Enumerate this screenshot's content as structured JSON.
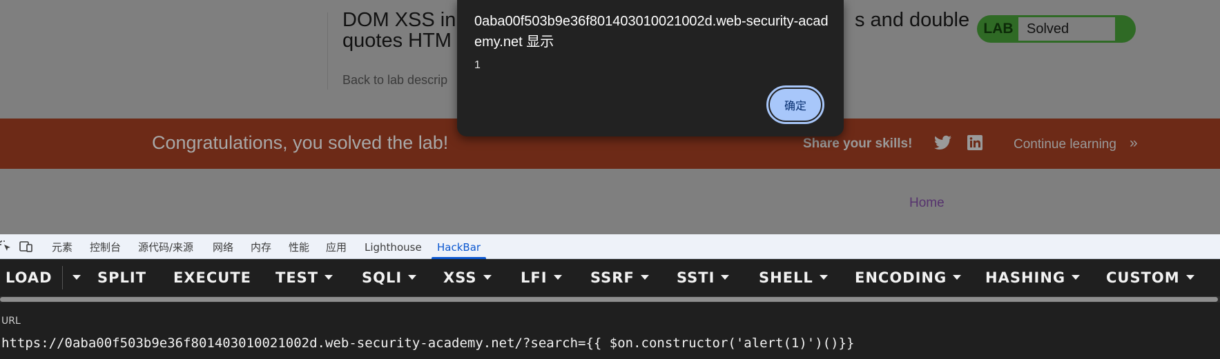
{
  "lab": {
    "title_line1": "DOM XSS in",
    "title_line2": "quotes HTM",
    "title_right": "s and double",
    "back_link": "Back to lab descrip",
    "badge_tag": "LAB",
    "badge_status": "Solved",
    "congrats": "Congratulations, you solved the lab!",
    "share": "Share your skills!",
    "continue": "Continue learning",
    "home": "Home",
    "colors": {
      "banner": "#6d2a17",
      "badge": "#2f6a25"
    }
  },
  "alert": {
    "origin": "0aba00f503b9e36f801403010021002d.web-security-academy.net 显示",
    "message": "1",
    "ok_label": "确定"
  },
  "devtools": {
    "tabs": [
      {
        "label": "元素"
      },
      {
        "label": "控制台"
      },
      {
        "label": "源代码/来源"
      },
      {
        "label": "网络"
      },
      {
        "label": "内存"
      },
      {
        "label": "性能"
      },
      {
        "label": "应用"
      },
      {
        "label": "Lighthouse"
      },
      {
        "label": "HackBar",
        "active": true
      }
    ]
  },
  "hackbar": {
    "buttons": [
      {
        "label": "LOAD"
      },
      {
        "label": "SPLIT"
      },
      {
        "label": "EXECUTE"
      },
      {
        "label": "TEST"
      },
      {
        "label": "SQLI"
      },
      {
        "label": "XSS"
      },
      {
        "label": "LFI"
      },
      {
        "label": "SSRF"
      },
      {
        "label": "SSTI"
      },
      {
        "label": "SHELL"
      },
      {
        "label": "ENCODING"
      },
      {
        "label": "HASHING"
      },
      {
        "label": "CUSTOM"
      }
    ],
    "url_label": "URL",
    "url_value": "https://0aba00f503b9e36f801403010021002d.web-security-academy.net/?search={{ $on.constructor('alert(1)')()}}"
  }
}
